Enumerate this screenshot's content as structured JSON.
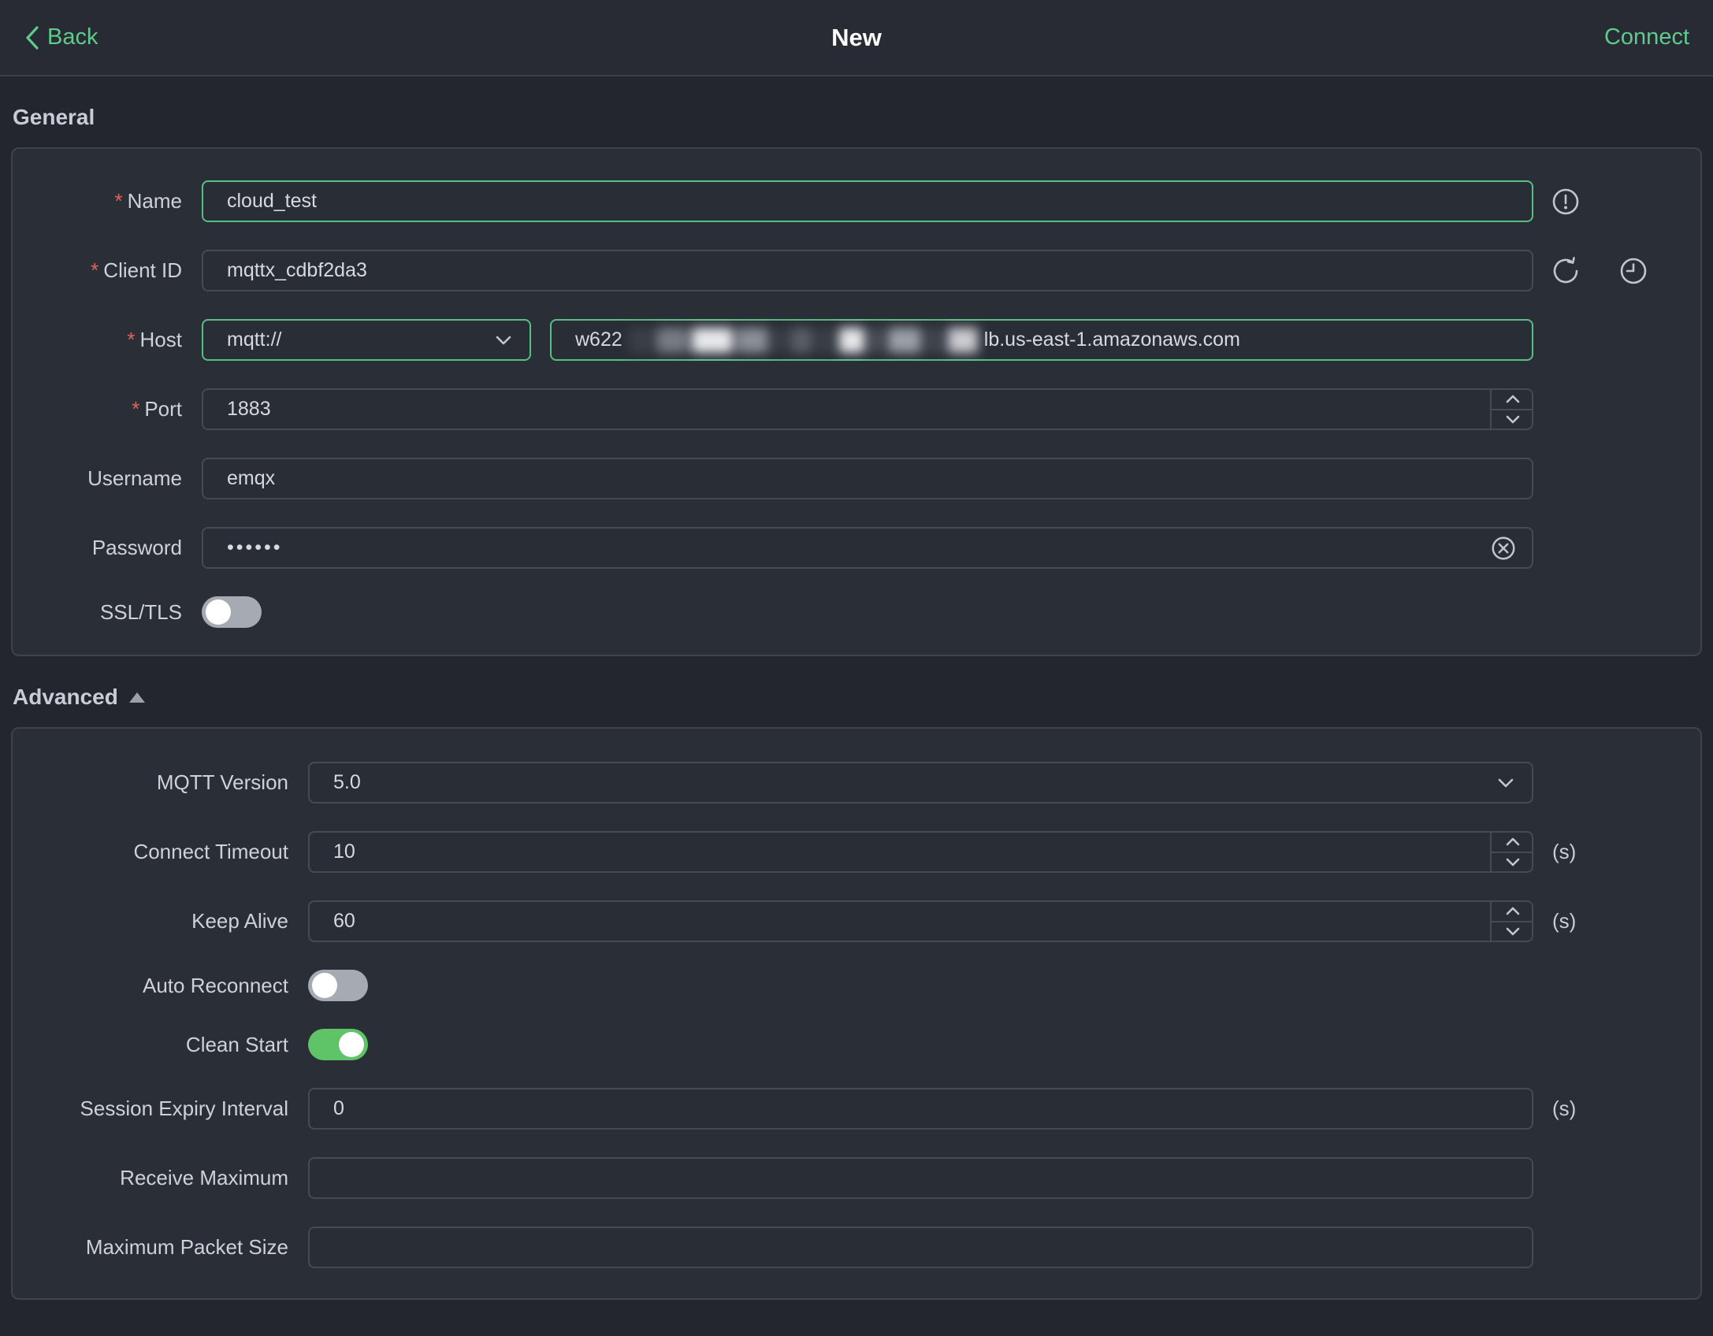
{
  "header": {
    "back_label": "Back",
    "title": "New",
    "connect_label": "Connect"
  },
  "required_marker": "*",
  "sections": {
    "general_title": "General",
    "advanced_title": "Advanced"
  },
  "general": {
    "name": {
      "label": "Name",
      "required": true,
      "value": "cloud_test"
    },
    "client_id": {
      "label": "Client ID",
      "required": true,
      "value": "mqttx_cdbf2da3"
    },
    "host": {
      "label": "Host",
      "required": true,
      "protocol": "mqtt://",
      "value_prefix": "w622",
      "value_redacted": true,
      "value_suffix": "lb.us-east-1.amazonaws.com"
    },
    "port": {
      "label": "Port",
      "required": true,
      "value": "1883"
    },
    "username": {
      "label": "Username",
      "required": false,
      "value": "emqx"
    },
    "password": {
      "label": "Password",
      "required": false,
      "value": "••••••"
    },
    "ssl": {
      "label": "SSL/TLS",
      "enabled": false
    }
  },
  "advanced": {
    "mqtt_version": {
      "label": "MQTT Version",
      "value": "5.0"
    },
    "connect_timeout": {
      "label": "Connect Timeout",
      "value": "10",
      "suffix": "(s)"
    },
    "keep_alive": {
      "label": "Keep Alive",
      "value": "60",
      "suffix": "(s)"
    },
    "auto_reconnect": {
      "label": "Auto Reconnect",
      "enabled": false
    },
    "clean_start": {
      "label": "Clean Start",
      "enabled": true
    },
    "session_expiry": {
      "label": "Session Expiry Interval",
      "value": "0",
      "suffix": "(s)"
    },
    "receive_maximum": {
      "label": "Receive Maximum",
      "value": ""
    },
    "max_packet_size": {
      "label": "Maximum Packet Size",
      "value": ""
    }
  },
  "icons": {
    "back": "chevron-left-icon",
    "name_hint": "warning-circle-icon",
    "client_id_refresh": "refresh-icon",
    "client_id_history": "history-clock-icon",
    "password_clear": "circle-close-icon",
    "selects": "chevron-down-icon",
    "steppers": "chevron-up-down-icons",
    "advanced_collapse": "triangle-up-icon"
  },
  "colors": {
    "accent_green_text": "#5ecb8c",
    "focus_border_green": "#56c083",
    "toggle_on_green": "#5fc368",
    "toggle_off_gray": "#a6abb3",
    "required_red": "#e0635f",
    "page_bg": "#23262e",
    "header_bg": "#282b33",
    "card_bg": "#2a2e37"
  }
}
